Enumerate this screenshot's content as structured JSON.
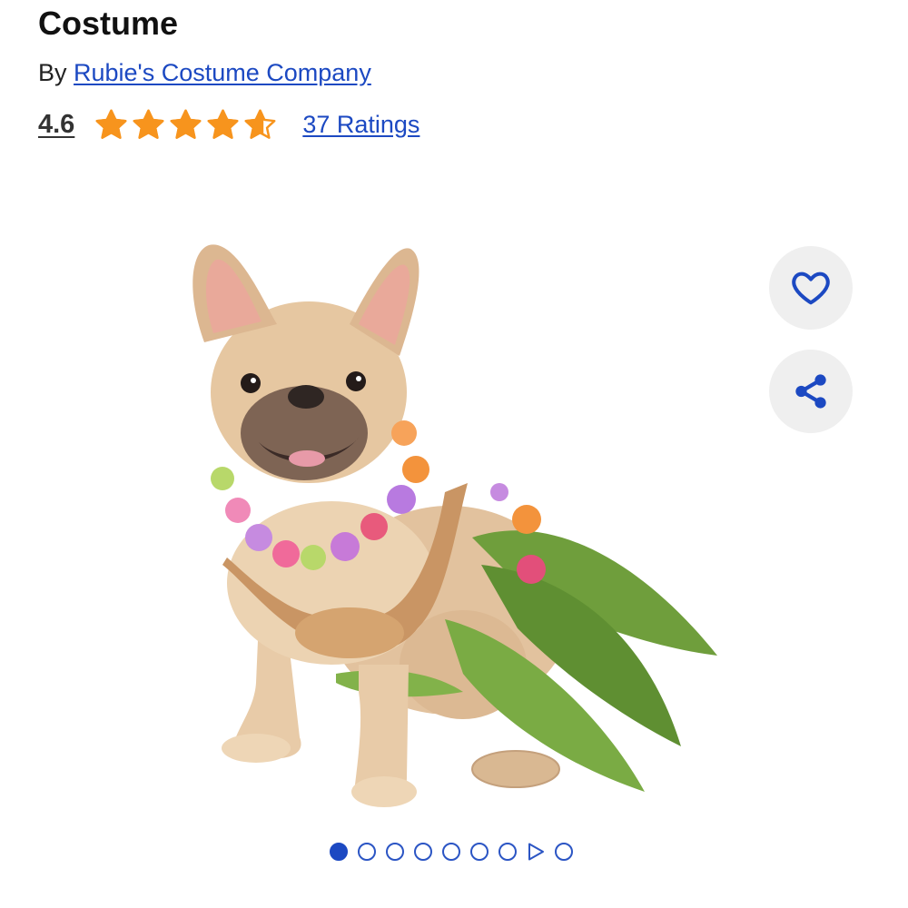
{
  "product": {
    "title": "Costume",
    "by_prefix": "By ",
    "brand": "Rubie's Costume Company",
    "rating_value": "4.6",
    "rating_fraction": 0.92,
    "stars_max": 5,
    "ratings_link": "37 Ratings"
  },
  "actions": {
    "favorite_icon": "heart-icon",
    "share_icon": "share-icon"
  },
  "gallery": {
    "image_subject": "French bulldog in hula costume",
    "total_items": 9,
    "active_index": 0,
    "video_index": 7
  },
  "colors": {
    "link": "#1c49c2",
    "star": "#f7941d",
    "fab_bg": "#efefef",
    "dot": "#1c49c2"
  }
}
